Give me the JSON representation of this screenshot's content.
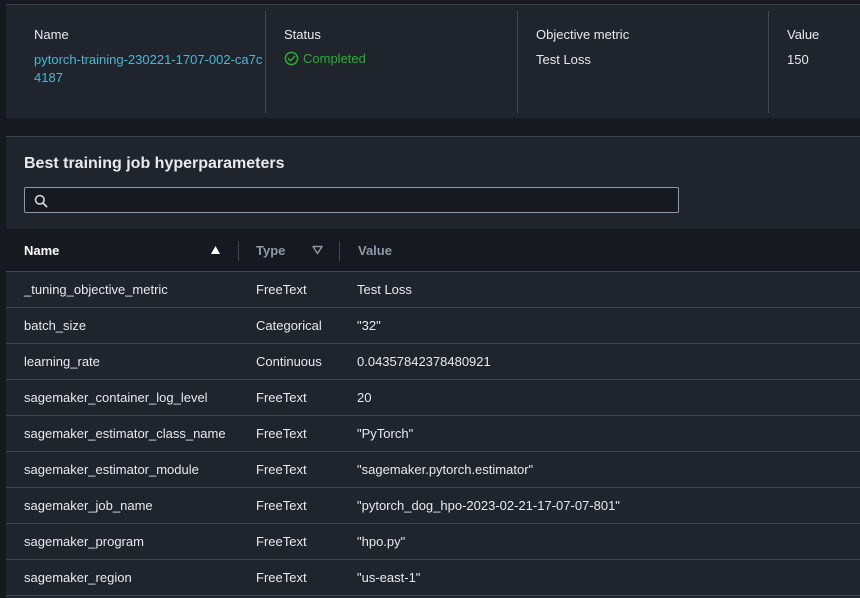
{
  "summary": {
    "name_label": "Name",
    "name_value": "pytorch-training-230221-1707-002-ca7c4187",
    "status_label": "Status",
    "status_value": "Completed",
    "objective_label": "Objective metric",
    "objective_value": "Test Loss",
    "value_label": "Value",
    "value_value": "150"
  },
  "panel": {
    "title": "Best training job hyperparameters",
    "search_placeholder": ""
  },
  "table": {
    "headers": {
      "name": "Name",
      "type": "Type",
      "value": "Value"
    },
    "rows": [
      {
        "name": "_tuning_objective_metric",
        "type": "FreeText",
        "value": "Test Loss"
      },
      {
        "name": "batch_size",
        "type": "Categorical",
        "value": "\"32\""
      },
      {
        "name": "learning_rate",
        "type": "Continuous",
        "value": "0.04357842378480921"
      },
      {
        "name": "sagemaker_container_log_level",
        "type": "FreeText",
        "value": "20"
      },
      {
        "name": "sagemaker_estimator_class_name",
        "type": "FreeText",
        "value": "\"PyTorch\""
      },
      {
        "name": "sagemaker_estimator_module",
        "type": "FreeText",
        "value": "\"sagemaker.pytorch.estimator\""
      },
      {
        "name": "sagemaker_job_name",
        "type": "FreeText",
        "value": "\"pytorch_dog_hpo-2023-02-21-17-07-07-801\""
      },
      {
        "name": "sagemaker_program",
        "type": "FreeText",
        "value": "\"hpo.py\""
      },
      {
        "name": "sagemaker_region",
        "type": "FreeText",
        "value": "\"us-east-1\""
      }
    ]
  },
  "colors": {
    "background": "#16191f",
    "panel": "#20252d",
    "link": "#44b9d6",
    "success": "#29ad32"
  },
  "icons": {
    "status": "check-circle-icon",
    "search": "search-icon",
    "sort_name": "caret-up-icon",
    "sort_type": "caret-down-icon"
  }
}
